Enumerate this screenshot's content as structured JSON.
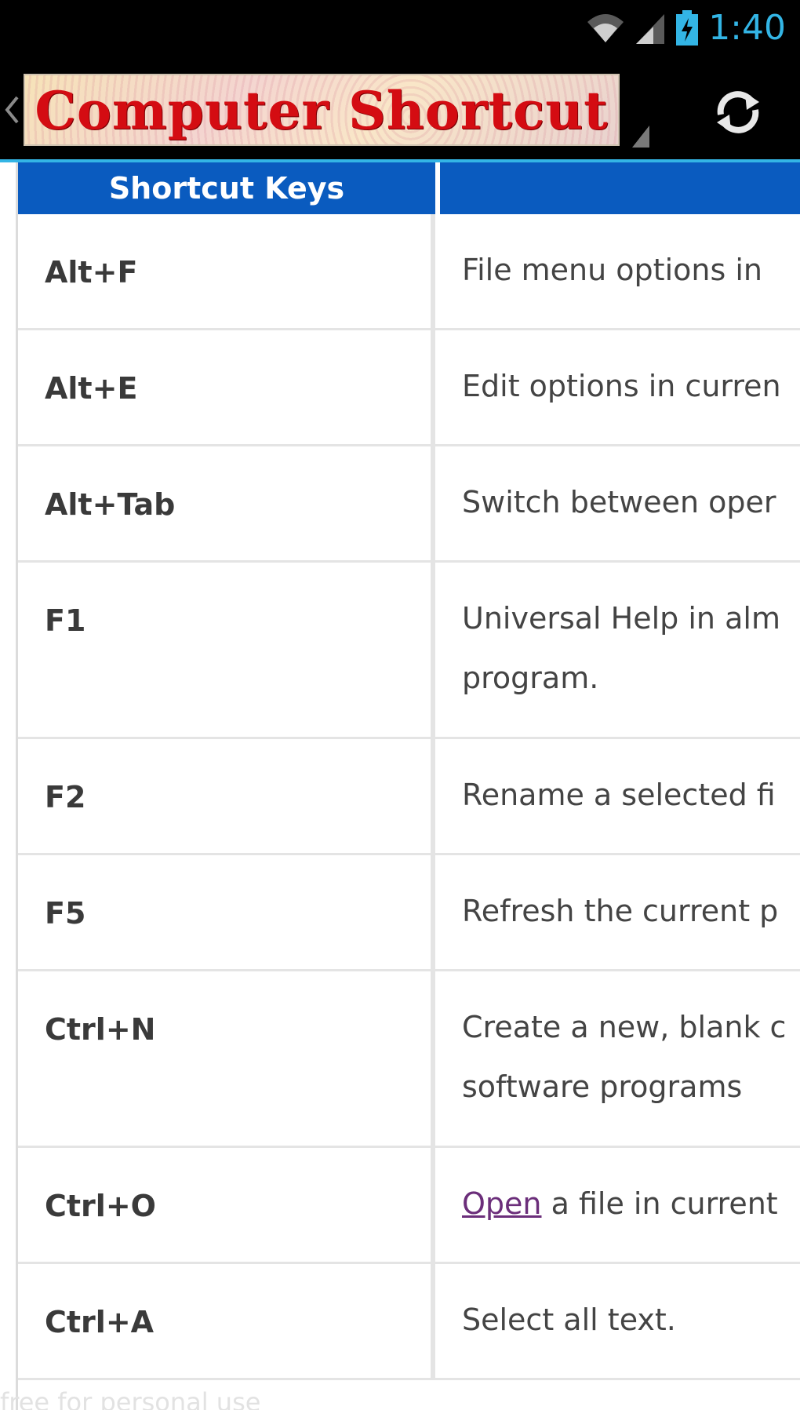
{
  "status_bar": {
    "time": "1:40",
    "accent_color": "#33b5e5",
    "icons": [
      "wifi-icon",
      "cell-signal-icon",
      "battery-charging-icon"
    ]
  },
  "action_bar": {
    "title": "Computer Shortcut Key",
    "icons": [
      "up-chevron-icon",
      "refresh-icon"
    ]
  },
  "table": {
    "header_color": "#0a5bbf",
    "columns": [
      "Shortcut Keys",
      ""
    ],
    "rows": [
      {
        "key": "Alt+F",
        "desc": [
          "File menu options in"
        ]
      },
      {
        "key": "Alt+E",
        "desc": [
          "Edit options in curren"
        ]
      },
      {
        "key": "Alt+Tab",
        "desc": [
          "Switch between oper"
        ]
      },
      {
        "key": "F1",
        "desc": [
          "Universal Help in alm",
          "program."
        ]
      },
      {
        "key": "F2",
        "desc": [
          "Rename a selected fi"
        ]
      },
      {
        "key": "F5",
        "desc": [
          "Refresh the current p"
        ]
      },
      {
        "key": "Ctrl+N",
        "desc": [
          "Create a new, blank c",
          "software programs"
        ]
      },
      {
        "key": "Ctrl+O",
        "desc_link": "Open",
        "desc_rest": " a file in current"
      },
      {
        "key": "Ctrl+A",
        "desc": [
          "Select all text."
        ]
      }
    ]
  },
  "footer_text": "free for personal use"
}
